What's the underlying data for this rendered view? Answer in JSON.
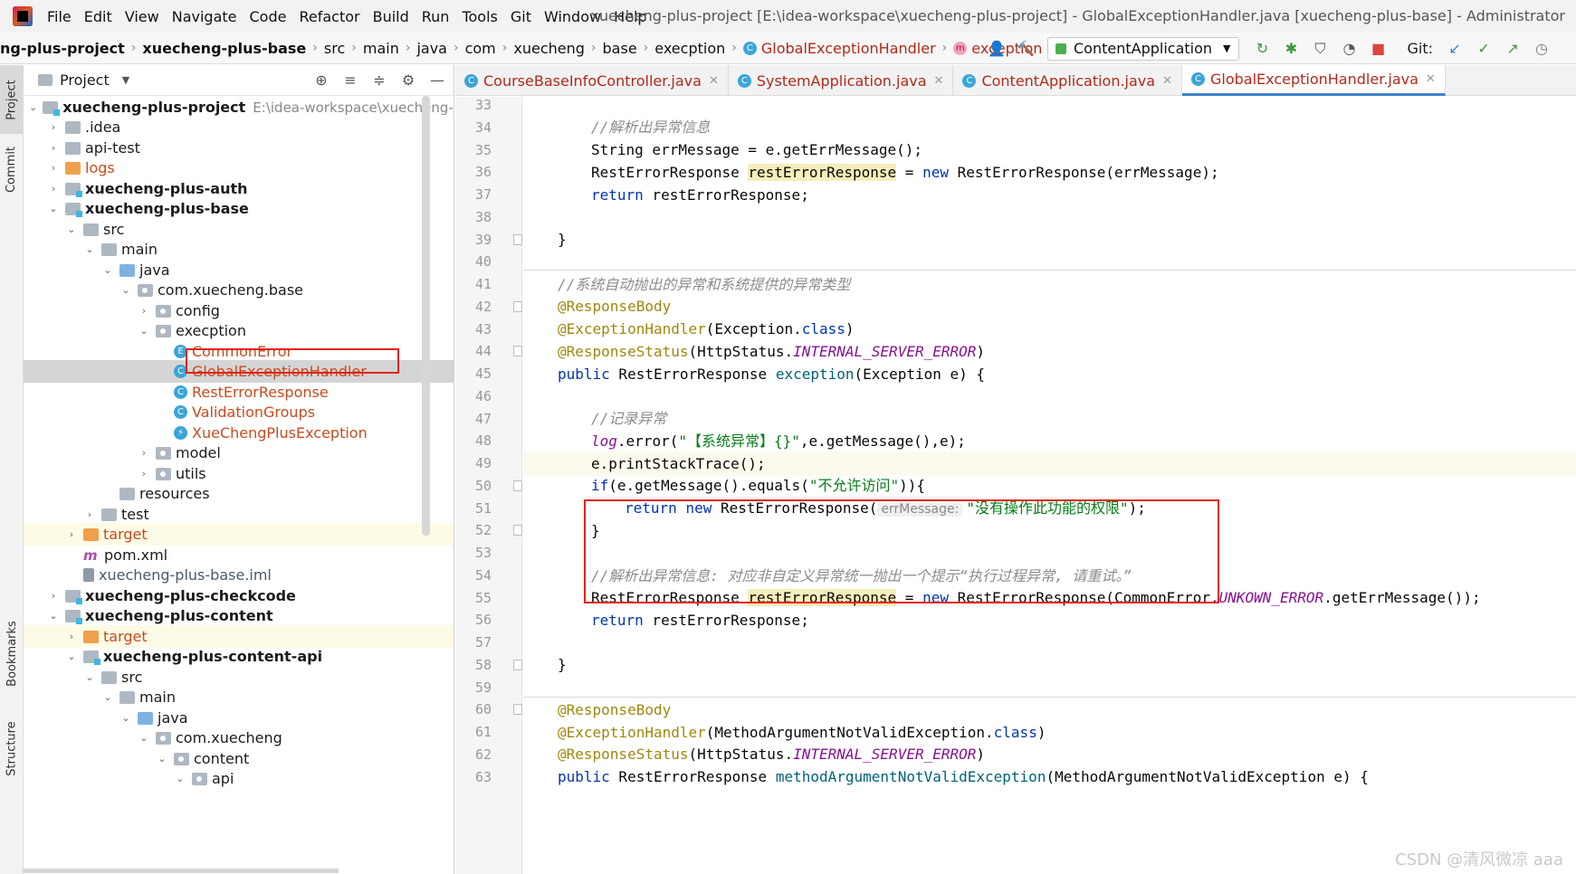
{
  "menubar": {
    "items": [
      "File",
      "Edit",
      "View",
      "Navigate",
      "Code",
      "Refactor",
      "Build",
      "Run",
      "Tools",
      "Git",
      "Window",
      "Help"
    ],
    "window_title": "xuecheng-plus-project [E:\\idea-workspace\\xuecheng-plus-project] - GlobalExceptionHandler.java [xuecheng-plus-base] - Administrator"
  },
  "navbar": {
    "crumbs": [
      "ng-plus-project",
      "xuecheng-plus-base",
      "src",
      "main",
      "java",
      "com",
      "xuecheng",
      "base",
      "execption",
      "GlobalExceptionHandler",
      "exception"
    ],
    "run_config": "ContentApplication",
    "git_label": "Git:"
  },
  "toolstrip": {
    "tabs": [
      "Project",
      "Commit",
      "Bookmarks",
      "Structure"
    ]
  },
  "project_panel": {
    "title": "Project",
    "tree": [
      {
        "label": "xuecheng-plus-project",
        "path": "E:\\idea-workspace\\xuecheng-plu"
      },
      {
        "label": ".idea"
      },
      {
        "label": "api-test"
      },
      {
        "label": "logs"
      },
      {
        "label": "xuecheng-plus-auth"
      },
      {
        "label": "xuecheng-plus-base"
      },
      {
        "label": "src"
      },
      {
        "label": "main"
      },
      {
        "label": "java"
      },
      {
        "label": "com.xuecheng.base"
      },
      {
        "label": "config"
      },
      {
        "label": "execption"
      },
      {
        "label": "CommonError"
      },
      {
        "label": "GlobalExceptionHandler"
      },
      {
        "label": "RestErrorResponse"
      },
      {
        "label": "ValidationGroups"
      },
      {
        "label": "XueChengPlusException"
      },
      {
        "label": "model"
      },
      {
        "label": "utils"
      },
      {
        "label": "resources"
      },
      {
        "label": "test"
      },
      {
        "label": "target"
      },
      {
        "label": "pom.xml"
      },
      {
        "label": "xuecheng-plus-base.iml"
      },
      {
        "label": "xuecheng-plus-checkcode"
      },
      {
        "label": "xuecheng-plus-content"
      },
      {
        "label": "target"
      },
      {
        "label": "xuecheng-plus-content-api"
      },
      {
        "label": "src"
      },
      {
        "label": "main"
      },
      {
        "label": "java"
      },
      {
        "label": "com.xuecheng"
      },
      {
        "label": "content"
      },
      {
        "label": "api"
      }
    ]
  },
  "editor": {
    "tabs": [
      {
        "label": "CourseBaseInfoController.java"
      },
      {
        "label": "SystemApplication.java"
      },
      {
        "label": "ContentApplication.java"
      },
      {
        "label": "GlobalExceptionHandler.java"
      }
    ],
    "line_numbers": [
      "33",
      "34",
      "35",
      "36",
      "37",
      "38",
      "39",
      "40",
      "41",
      "42",
      "43",
      "44",
      "45",
      "46",
      "47",
      "48",
      "49",
      "50",
      "51",
      "52",
      "53",
      "54",
      "55",
      "56",
      "57",
      "58",
      "59",
      "60",
      "61",
      "62",
      "63"
    ],
    "tokens": {
      "l34_c": "//解析出异常信息",
      "l35_a": "String errMessage = e.getErrMessage();",
      "l36_a": "RestErrorResponse ",
      "l36_b": "restErrorResponse",
      "l36_c": " = ",
      "l36_d": "new",
      "l36_e": " RestErrorResponse(errMessage);",
      "l37_a": "return",
      "l37_b": " restErrorResponse;",
      "l39_a": "}",
      "l41_c": "//系统自动抛出的异常和系统提供的异常类型",
      "l42_a": "@ResponseBody",
      "l43_a": "@ExceptionHandler",
      "l43_b": "(Exception.",
      "l43_c": "class",
      "l43_d": ")",
      "l44_a": "@ResponseStatus",
      "l44_b": "(HttpStatus.",
      "l44_c": "INTERNAL_SERVER_ERROR",
      "l44_d": ")",
      "l45_a": "public",
      "l45_b": " RestErrorResponse ",
      "l45_c": "exception",
      "l45_d": "(Exception e) {",
      "l47_c": "//记录异常",
      "l48_a": "log",
      "l48_b": ".error(",
      "l48_c": "\"【系统异常】{}\"",
      "l48_d": ",e.getMessage(),e);",
      "l49_a": "e.printStackTrace();",
      "l50_a": "if",
      "l50_b": "(e.getMessage().equals(",
      "l50_c": "\"不允许访问\"",
      "l50_d": ")){",
      "l51_a": "return",
      "l51_b": " ",
      "l51_c": "new",
      "l51_d": " RestErrorResponse(",
      "l51_hint": "errMessage:",
      "l51_e": "\"没有操作此功能的权限\"",
      "l51_f": ");",
      "l52_a": "}",
      "l54_c": "//解析出异常信息: 对应非自定义异常统一抛出一个提示“执行过程异常, 请重试。”",
      "l55_a": "RestErrorResponse ",
      "l55_b": "restErrorResponse",
      "l55_c": " = ",
      "l55_d": "new",
      "l55_e": " RestErrorResponse(CommonError.",
      "l55_f": "UNKOWN_ERROR",
      "l55_g": ".getErrMessage());",
      "l56_a": "return",
      "l56_b": " restErrorResponse;",
      "l58_a": "}",
      "l60_a": "@ResponseBody",
      "l61_a": "@ExceptionHandler",
      "l61_b": "(MethodArgumentNotValidException.",
      "l61_c": "class",
      "l61_d": ")",
      "l62_a": "@ResponseStatus",
      "l62_b": "(HttpStatus.",
      "l62_c": "INTERNAL_SERVER_ERROR",
      "l62_d": ")",
      "l63_a": "public",
      "l63_b": " RestErrorResponse ",
      "l63_c": "methodArgumentNotValidException",
      "l63_d": "(MethodArgumentNotValidException e) {"
    }
  },
  "watermark": "CSDN @清风微凉 aaa",
  "colors": {
    "keyword": "#0033b3",
    "comment": "#8c8c8c",
    "annotation": "#9e880d",
    "string": "#067d17",
    "method": "#00627a",
    "static_field": "#871094",
    "highlight_box": "#e1251b"
  }
}
